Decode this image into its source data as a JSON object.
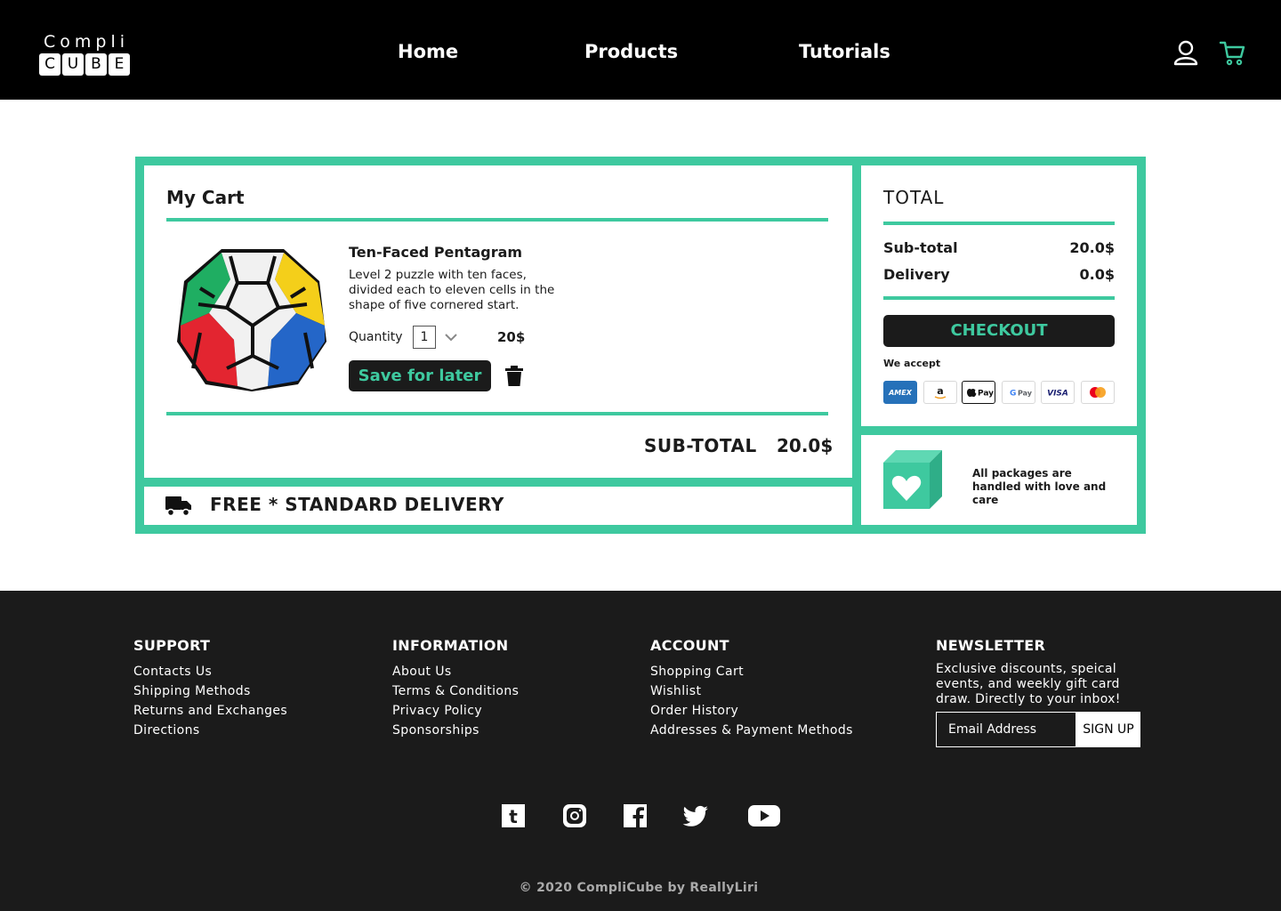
{
  "header": {
    "logo_top": "Compli",
    "logo_letters": [
      "C",
      "U",
      "B",
      "E"
    ],
    "nav": [
      "Home",
      "Products",
      "Tutorials"
    ],
    "icons": [
      "user-icon",
      "cart-icon"
    ]
  },
  "cart": {
    "title": "My Cart",
    "item": {
      "name": "Ten-Faced Pentagram",
      "description": "Level 2 puzzle with ten faces, divided each to eleven cells in the shape of five cornered start.",
      "quantity_label": "Quantity",
      "quantity": "1",
      "price": "20$",
      "save_label": "Save for later"
    },
    "subtotal_label": "SUB-TOTAL",
    "subtotal_value": "20.0$"
  },
  "delivery": {
    "text": "FREE * STANDARD DELIVERY"
  },
  "total": {
    "title": "TOTAL",
    "rows": [
      {
        "label": "Sub-total",
        "value": "20.0$"
      },
      {
        "label": "Delivery",
        "value": "0.0$"
      }
    ],
    "checkout_label": "CHECKOUT",
    "we_accept": "We accept",
    "payment_methods": [
      "amex",
      "amazon-pay",
      "apple-pay",
      "google-pay",
      "visa",
      "mastercard"
    ]
  },
  "love": {
    "text": "All packages are handled with love and care"
  },
  "footer": {
    "columns": [
      {
        "heading": "SUPPORT",
        "links": [
          "Contacts Us",
          "Shipping Methods",
          "Returns and Exchanges",
          "Directions"
        ]
      },
      {
        "heading": "INFORMATION",
        "links": [
          "About Us",
          "Terms & Conditions",
          "Privacy Policy",
          "Sponsorships"
        ]
      },
      {
        "heading": "ACCOUNT",
        "links": [
          "Shopping Cart",
          "Wishlist",
          "Order History",
          "Addresses & Payment Methods"
        ]
      }
    ],
    "newsletter": {
      "heading": "NEWSLETTER",
      "text": "Exclusive discounts, speical events, and weekly gift card draw. Directly to your inbox!",
      "placeholder": "Email Address",
      "signup_label": "SIGN UP"
    },
    "social": [
      "tumblr-icon",
      "instagram-icon",
      "facebook-icon",
      "twitter-icon",
      "youtube-icon"
    ],
    "copyright": "© 2020 CompliCube by ReallyLiri"
  },
  "colors": {
    "accent": "#3ec99f",
    "dark": "#1b1b1b",
    "header_bg": "#000000"
  }
}
